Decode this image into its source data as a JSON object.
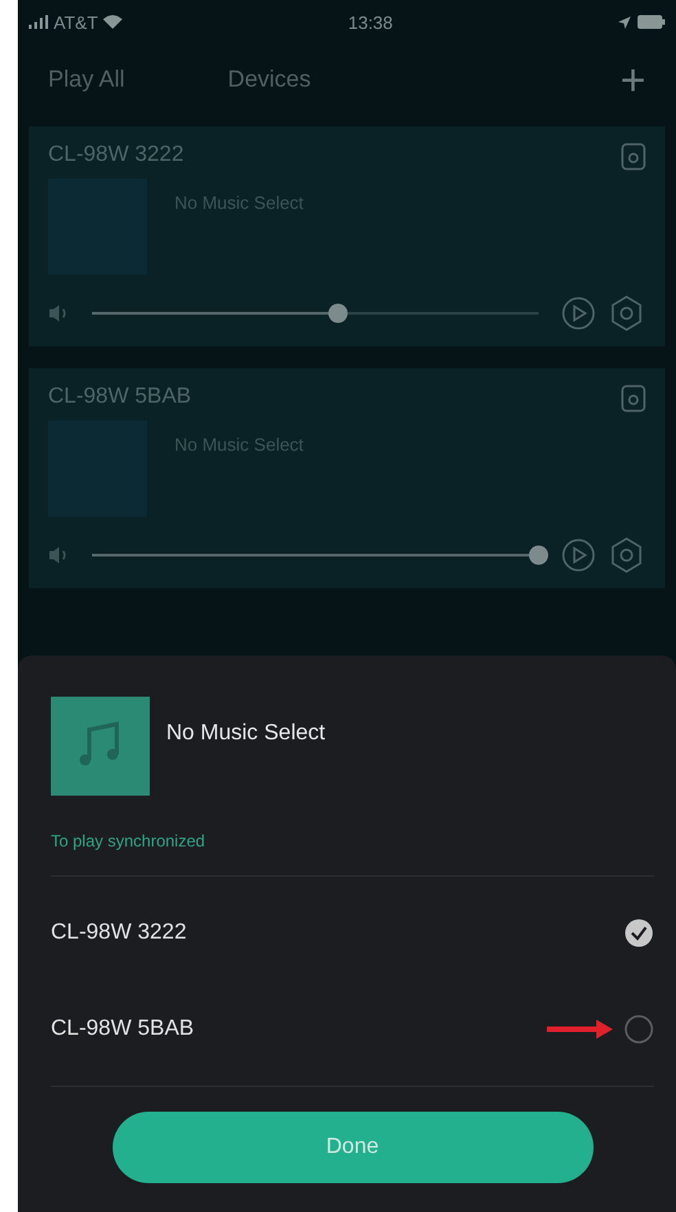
{
  "status_bar": {
    "carrier": "AT&T",
    "time": "13:38"
  },
  "nav": {
    "left": "Play All",
    "title": "Devices",
    "add": "+"
  },
  "devices": [
    {
      "name": "CL-98W 3222",
      "track": "No Music Select",
      "level": 0.55
    },
    {
      "name": "CL-98W 5BAB",
      "track": "No Music Select",
      "level": 1.0
    }
  ],
  "sheet": {
    "track": "No Music Select",
    "hint": "To play synchronized",
    "rows": [
      {
        "name": "CL-98W 3222",
        "checked": true,
        "pointer": false
      },
      {
        "name": "CL-98W 5BAB",
        "checked": false,
        "pointer": true
      }
    ],
    "button": "Done"
  }
}
